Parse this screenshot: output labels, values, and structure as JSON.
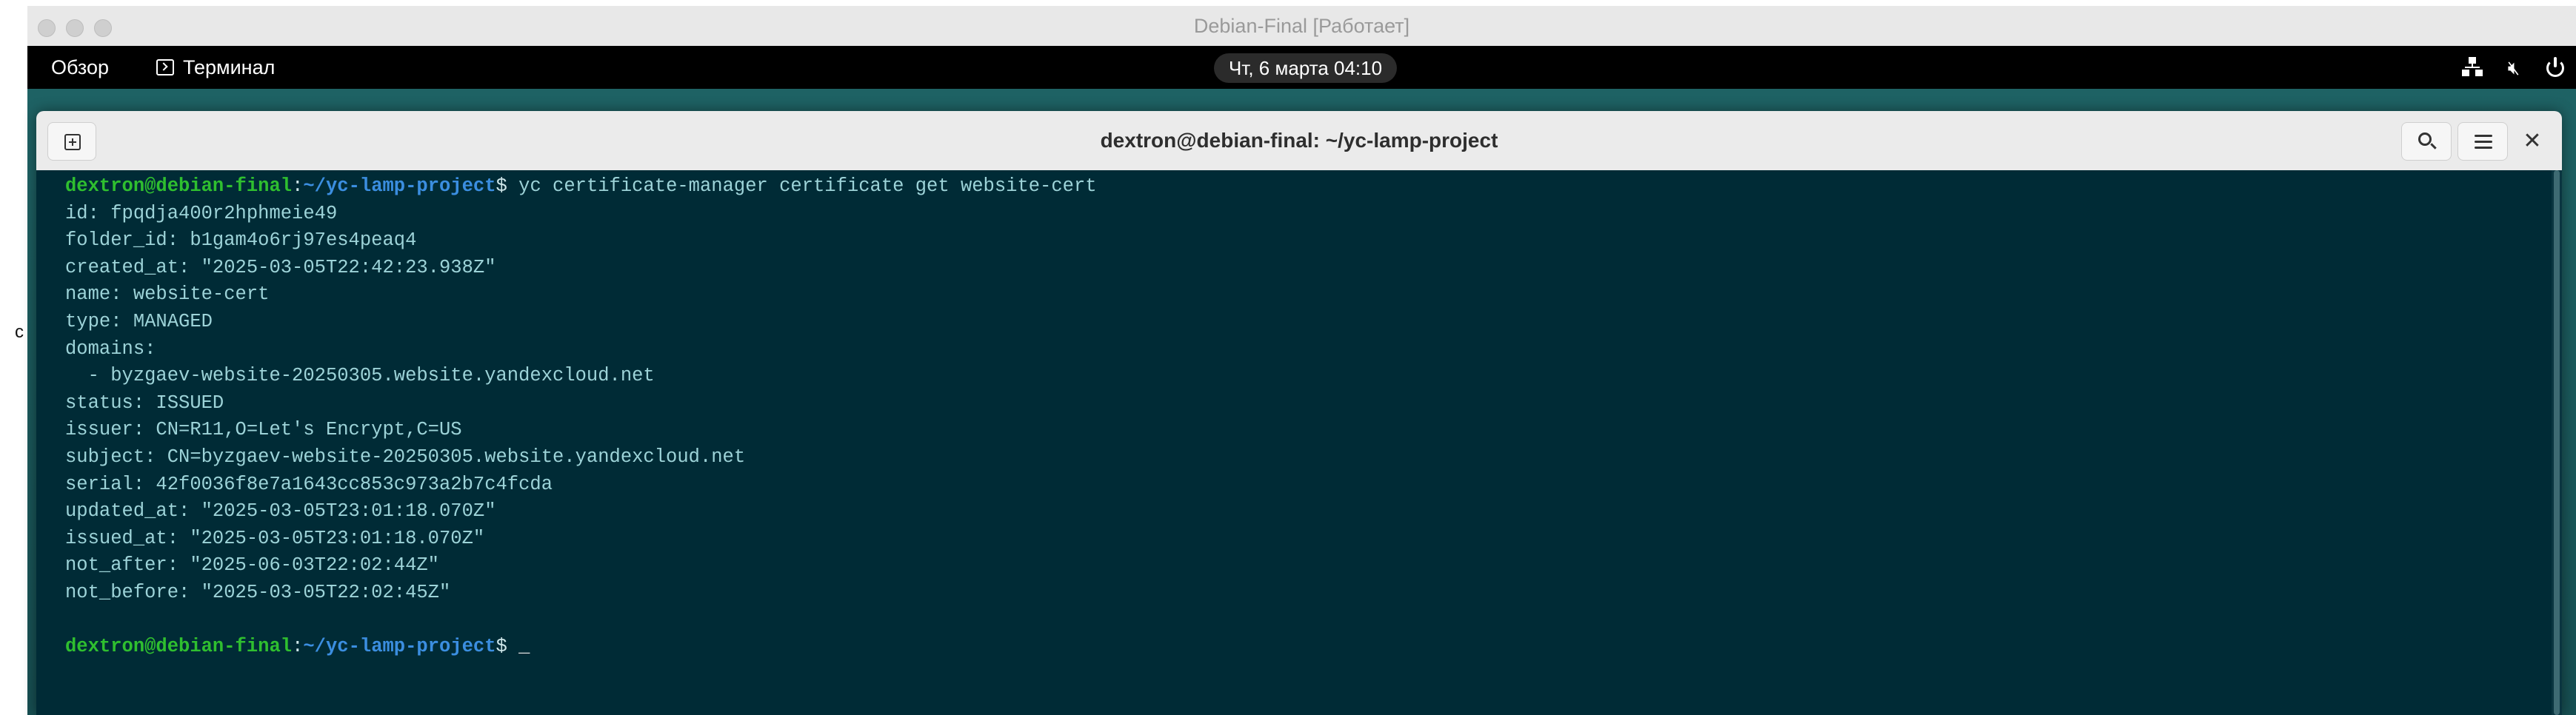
{
  "stray_text": "c",
  "host_window": {
    "title": "Debian-Final [Работает]"
  },
  "topbar": {
    "overview_label": "Обзор",
    "app_label": "Терминал",
    "clock": "Чт, 6 марта  04:10",
    "tray_icons": [
      "network-icon",
      "volume-muted-icon",
      "power-icon"
    ]
  },
  "terminal": {
    "title": "dextron@debian-final: ~/yc-lamp-project",
    "prompt_user": "dextron@debian-final",
    "prompt_sep": ":",
    "prompt_path": "~/yc-lamp-project",
    "prompt_symbol": "$ ",
    "command": "yc certificate-manager certificate get website-cert",
    "output": [
      "id: fpqdja400r2hphmeie49",
      "folder_id: b1gam4o6rj97es4peaq4",
      "created_at: \"2025-03-05T22:42:23.938Z\"",
      "name: website-cert",
      "type: MANAGED",
      "domains:",
      "  - byzgaev-website-20250305.website.yandexcloud.net",
      "status: ISSUED",
      "issuer: CN=R11,O=Let's Encrypt,C=US",
      "subject: CN=byzgaev-website-20250305.website.yandexcloud.net",
      "serial: 42f0036f8e7a1643cc853c973a2b7c4fcda",
      "updated_at: \"2025-03-05T23:01:18.070Z\"",
      "issued_at: \"2025-03-05T23:01:18.070Z\"",
      "not_after: \"2025-06-03T22:02:44Z\"",
      "not_before: \"2025-03-05T22:02:45Z\"",
      ""
    ],
    "cursor": "_"
  },
  "colors": {
    "terminal_bg": "#002b36",
    "terminal_fg": "#9dd3d8",
    "prompt_user": "#2fbf2f",
    "prompt_path": "#3b8ee0",
    "desktop": "#1a5a5c"
  }
}
